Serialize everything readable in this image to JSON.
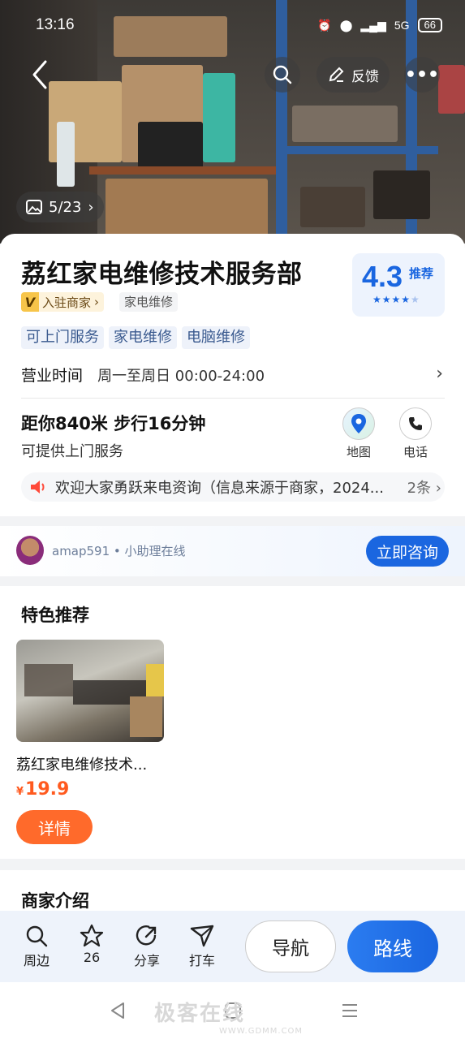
{
  "status": {
    "time": "13:16",
    "network": "5G",
    "battery": "66"
  },
  "hero": {
    "feedback_label": "反馈",
    "photo_counter": "5/23"
  },
  "poi": {
    "name": "荔红家电维修技术服务部",
    "rating": "4.3",
    "rating_tag": "推荐",
    "rating_stars": 4,
    "merchant_badge": "入驻商家",
    "merchant_badge_letter": "V",
    "category": "家电维修",
    "tags": [
      "可上门服务",
      "家电维修",
      "电脑维修"
    ],
    "hours_label": "营业时间",
    "hours_value": "周一至周日 00:00-24:00",
    "distance": "距你840米  步行16分钟",
    "service_note": "可提供上门服务",
    "map_label": "地图",
    "phone_label": "电话",
    "notice_text": "欢迎大家勇跃来电资询（信息来源于商家，2024...",
    "notice_count": "2条"
  },
  "assistant": {
    "name": "amap591 • 小助理在线",
    "consult_label": "立即咨询"
  },
  "featured": {
    "heading": "特色推荐",
    "item_name": "荔红家电维修技术...",
    "currency": "¥",
    "price": "19.9",
    "detail_label": "详情"
  },
  "intro": {
    "heading": "商家介绍"
  },
  "toolbar": {
    "nearby_label": "周边",
    "favorite_count": "26",
    "share_label": "分享",
    "taxi_label": "打车",
    "navigate_label": "导航",
    "route_label": "路线"
  },
  "watermark": {
    "text": "极客在线",
    "url": "WWW.GDMM.COM"
  },
  "colors": {
    "brand_blue": "#1a66e0",
    "price_orange": "#ff5a1f",
    "detail_orange": "#ff6a2b"
  }
}
